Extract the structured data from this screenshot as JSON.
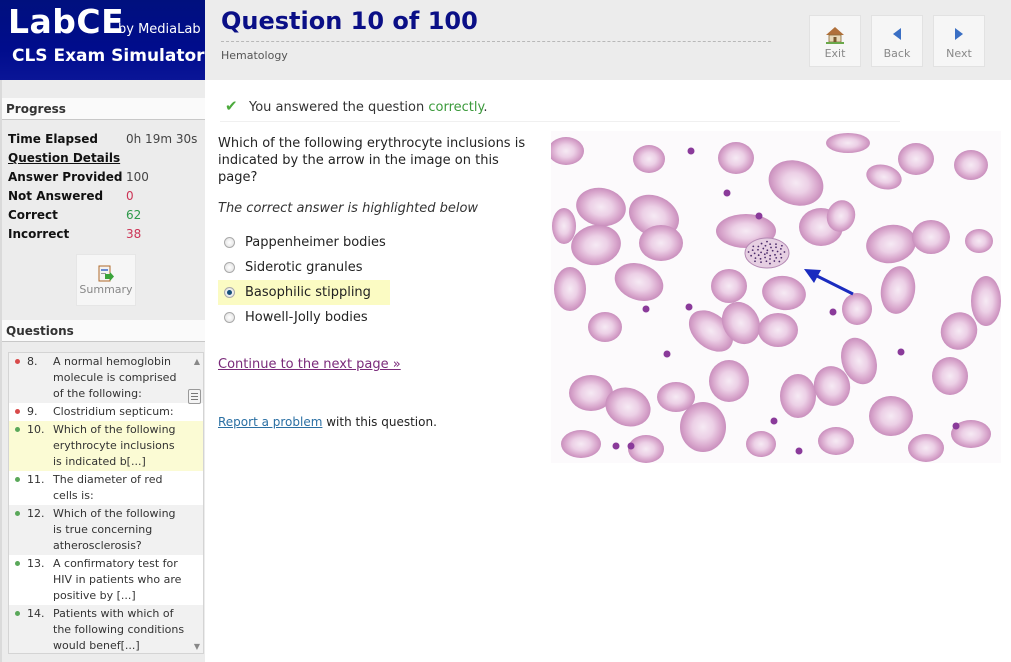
{
  "logo": {
    "brand": "LabCE",
    "by": "by MediaLab",
    "subtitle": "CLS Exam Simulator"
  },
  "header": {
    "title": "Question 10 of 100",
    "category": "Hematology",
    "buttons": [
      {
        "label": "Exit",
        "icon": "home-icon"
      },
      {
        "label": "Back",
        "icon": "arrow-left-icon"
      },
      {
        "label": "Next",
        "icon": "arrow-right-icon"
      }
    ]
  },
  "sidebar": {
    "progress_heading": "Progress",
    "time_elapsed_label": "Time Elapsed",
    "time_elapsed_value": "0h 19m 30s",
    "details_heading": "Question Details",
    "stats": [
      {
        "label": "Answer Provided",
        "value": "100",
        "color": "#444444"
      },
      {
        "label": "Not Answered",
        "value": "0",
        "color": "#cc3355"
      },
      {
        "label": "Correct",
        "value": "62",
        "color": "#2e9a4a"
      },
      {
        "label": "Incorrect",
        "value": "38",
        "color": "#cc3355"
      }
    ],
    "summary_label": "Summary",
    "questions_heading": "Questions",
    "questions": [
      {
        "num": "8.",
        "text": "A normal hemoglobin molecule is comprised of the following:",
        "status": "incorrect"
      },
      {
        "num": "9.",
        "text": "Clostridium septicum:",
        "status": "incorrect"
      },
      {
        "num": "10.",
        "text": "Which of the following erythrocyte inclusions is indicated b[...]",
        "status": "correct",
        "current": true
      },
      {
        "num": "11.",
        "text": "The diameter of red cells is:",
        "status": "correct"
      },
      {
        "num": "12.",
        "text": "Which of the following is true concerning atherosclerosis?",
        "status": "correct"
      },
      {
        "num": "13.",
        "text": "A confirmatory test for HIV in patients who are positive by [...]",
        "status": "correct"
      },
      {
        "num": "14.",
        "text": "Patients with which of the following conditions would benef[...]",
        "status": "correct"
      }
    ],
    "status_colors": {
      "correct": "#5aa85a",
      "incorrect": "#d84a4a"
    }
  },
  "main": {
    "result_prefix": "You answered the question ",
    "result_word": "correctly",
    "result_suffix": ".",
    "question": "Which of the following erythrocyte inclusions is indicated by the arrow in the image on this page?",
    "hint": "The correct answer is highlighted below",
    "options": [
      {
        "label": "Pappenheimer bodies",
        "selected": false
      },
      {
        "label": "Siderotic granules",
        "selected": false
      },
      {
        "label": "Basophilic stippling",
        "selected": true
      },
      {
        "label": "Howell-Jolly bodies",
        "selected": false
      }
    ],
    "continue_link": "Continue to the next page »",
    "report_link": "Report a problem",
    "report_suffix": " with this question."
  },
  "image": {
    "description": "Peripheral blood smear with arrow pointing to red cell showing basophilic stippling"
  }
}
